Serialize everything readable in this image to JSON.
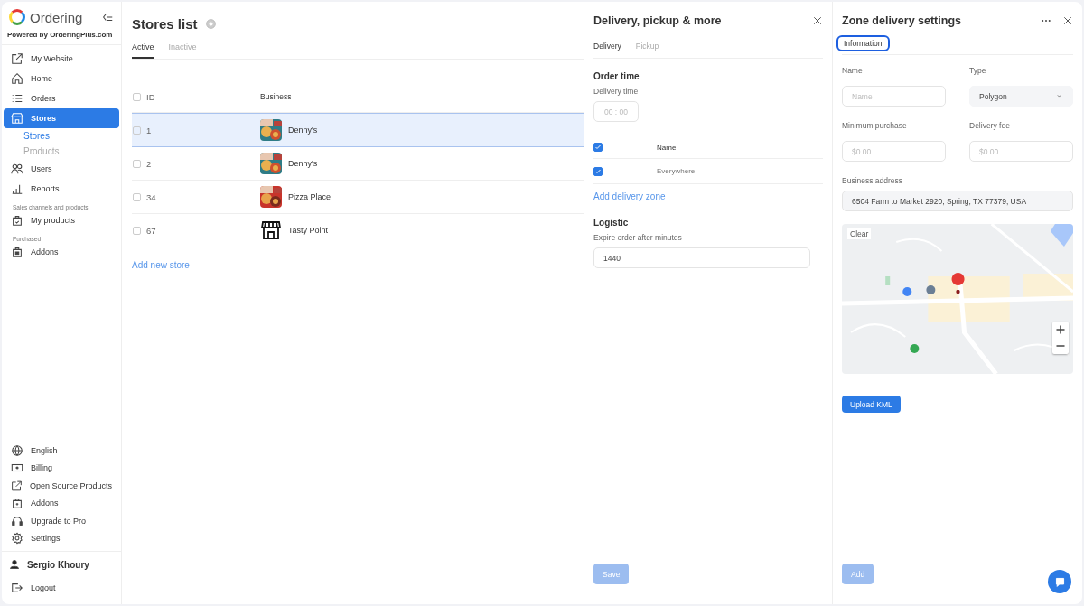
{
  "sidebar": {
    "logo": "Ordering",
    "powered_by": "Powered by OrderingPlus.com",
    "nav": [
      {
        "kind": "link",
        "label": "My Website",
        "selected": false
      },
      {
        "kind": "link",
        "label": "Home",
        "selected": false
      },
      {
        "kind": "link",
        "label": "Orders",
        "selected": false
      },
      {
        "kind": "link",
        "label": "Stores",
        "selected": true,
        "children": [
          {
            "label": "Stores",
            "selected": true
          },
          {
            "label": "Products",
            "selected": false
          }
        ]
      },
      {
        "kind": "link",
        "label": "Users",
        "selected": false
      },
      {
        "kind": "link",
        "label": "Reports",
        "selected": false
      },
      {
        "kind": "heading",
        "label": "Sales channels and products"
      },
      {
        "kind": "link",
        "label": "My products",
        "selected": false
      },
      {
        "kind": "heading",
        "label": "Purchased"
      },
      {
        "kind": "link",
        "label": "Addons",
        "selected": false
      }
    ],
    "bottom": [
      "English",
      "Billing",
      "Open Source Products",
      "Addons",
      "Upgrade to Pro",
      "Settings"
    ],
    "user": "Sergio Khoury",
    "logout": "Logout"
  },
  "stores": {
    "title": "Stores list",
    "tabs": [
      {
        "label": "Active",
        "selected": true
      },
      {
        "label": "Inactive",
        "selected": false
      }
    ],
    "columns": [
      "ID",
      "Business"
    ],
    "all_checked": false,
    "rows": [
      {
        "id": "1",
        "name": "Denny's",
        "has_photo": true,
        "checked": false,
        "selected": true
      },
      {
        "id": "2",
        "name": "Denny's",
        "has_photo": true,
        "checked": false,
        "selected": false
      },
      {
        "id": "34",
        "name": "Pizza Place",
        "has_photo": true,
        "checked": false,
        "selected": false
      },
      {
        "id": "67",
        "name": "Tasty Point",
        "has_photo": false,
        "checked": false,
        "selected": false
      }
    ],
    "add_link": "Add new store"
  },
  "delivery_panel": {
    "title": "Delivery, pickup & more",
    "tabs": [
      {
        "label": "Delivery",
        "selected": true
      },
      {
        "label": "Pickup",
        "selected": false
      }
    ],
    "order_time": "Order time",
    "delivery_time_label": "Delivery time",
    "time_placeholder": "00 : 00",
    "zones": {
      "header_checked": true,
      "column": "Name",
      "rows": [
        {
          "name": "Everywhere",
          "checked": true
        }
      ]
    },
    "add_zone": "Add delivery zone",
    "logistic": "Logistic",
    "expire_label": "Expire order after minutes",
    "expire_value": "1440",
    "save": {
      "label": "Save",
      "disabled": true
    }
  },
  "zone_panel": {
    "title": "Zone delivery settings",
    "tabs": [
      {
        "label": "Information",
        "selected": true
      }
    ],
    "name_label": "Name",
    "name_placeholder": "Name",
    "type_label": "Type",
    "type_value": "Polygon",
    "min_label": "Minimum purchase",
    "min_placeholder": "$0.00",
    "fee_label": "Delivery fee",
    "fee_placeholder": "$0.00",
    "address_label": "Business address",
    "address_value": "6504 Farm to Market 2920, Spring, TX 77379, USA",
    "map": {
      "clear": "Clear"
    },
    "upload": "Upload KML",
    "add": {
      "label": "Add",
      "disabled": true
    }
  }
}
